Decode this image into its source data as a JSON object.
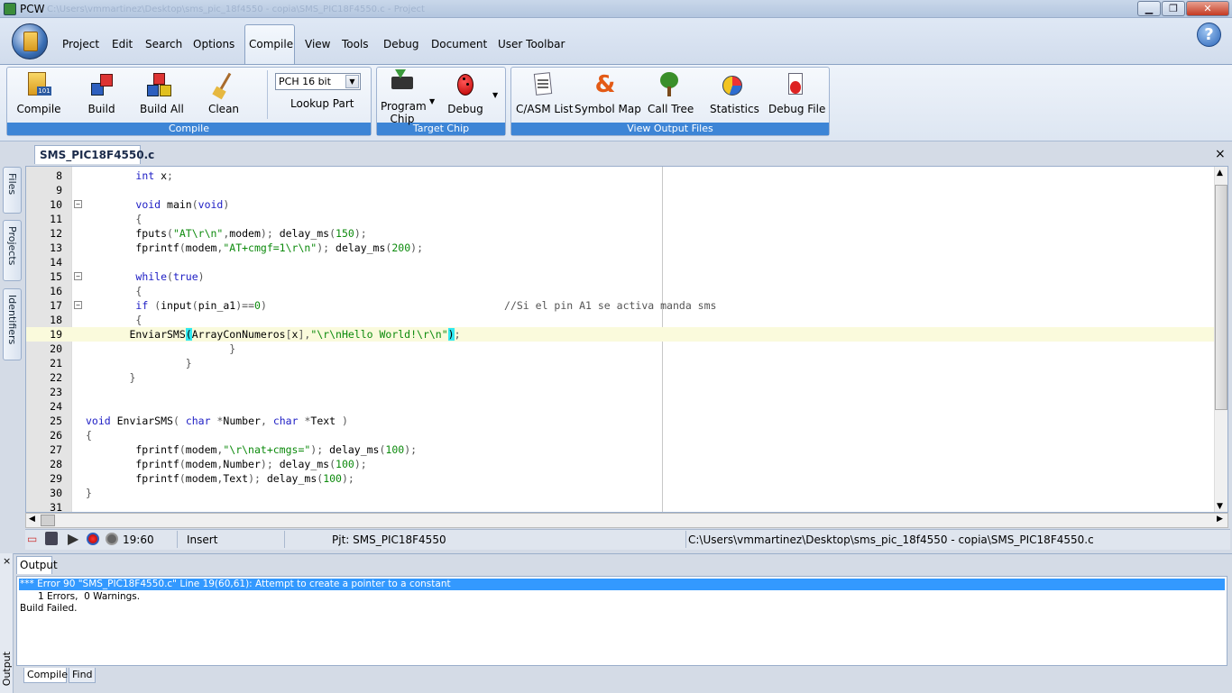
{
  "window": {
    "title": "PCW",
    "title_path": "C:\\Users\\vmmartinez\\Desktop\\sms_pic_18f4550 - copia\\SMS_PIC18F4550.c - Project",
    "controls": {
      "min": "▁",
      "max": "❐",
      "close": "✕"
    }
  },
  "menu": {
    "items": [
      "Project",
      "Edit",
      "Search",
      "Options",
      "Compile",
      "View",
      "Tools",
      "Debug",
      "Document",
      "User Toolbar"
    ],
    "active": "Compile",
    "help_icon": "?"
  },
  "ribbon": {
    "compile_group": {
      "label": "Compile",
      "buttons": [
        {
          "label": "Compile",
          "icon": "compile-icon"
        },
        {
          "label": "Build",
          "icon": "build-icon"
        },
        {
          "label": "Build All",
          "icon": "build-all-icon"
        },
        {
          "label": "Clean",
          "icon": "broom-icon"
        }
      ],
      "compiler_select": "PCH 16 bit",
      "lookup_part": "Lookup Part"
    },
    "target_group": {
      "label": "Target Chip",
      "buttons": [
        {
          "label": "Program Chip",
          "line1": "Program",
          "line2": "Chip",
          "icon": "chip-icon"
        },
        {
          "label": "Debug",
          "icon": "bug-icon"
        }
      ]
    },
    "output_group": {
      "label": "View Output Files",
      "buttons": [
        {
          "label": "C/ASM List",
          "icon": "list-icon"
        },
        {
          "label": "Symbol Map",
          "icon": "ampersand-icon"
        },
        {
          "label": "Call Tree",
          "icon": "tree-icon"
        },
        {
          "label": "Statistics",
          "icon": "pie-icon"
        },
        {
          "label": "Debug File",
          "icon": "debug-file-icon"
        }
      ]
    }
  },
  "editor": {
    "tab_name": "SMS_PIC18F4550.c",
    "close_label": "×",
    "side_tabs": [
      "Files",
      "Projects",
      "Identifiers"
    ]
  },
  "code_lines": [
    {
      "num": "8",
      "text": "        int x;"
    },
    {
      "num": "9",
      "text": ""
    },
    {
      "num": "10",
      "text": "        void main(void)"
    },
    {
      "num": "11",
      "text": "        {"
    },
    {
      "num": "12",
      "text": "        fputs(\"AT\\r\\n\",modem); delay_ms(150);"
    },
    {
      "num": "13",
      "text": "        fprintf(modem,\"AT+cmgf=1\\r\\n\"); delay_ms(200);"
    },
    {
      "num": "14",
      "text": ""
    },
    {
      "num": "15",
      "text": "        while(true)"
    },
    {
      "num": "16",
      "text": "        {"
    },
    {
      "num": "17",
      "text": "        if (input(pin_a1)==0)                                      //Si el pin A1 se activa manda sms"
    },
    {
      "num": "18",
      "text": "        {"
    },
    {
      "num": "19",
      "text": "       EnviarSMS(ArrayConNumeros[x],\"\\r\\nHello World!\\r\\n\");"
    },
    {
      "num": "20",
      "text": "                       }"
    },
    {
      "num": "21",
      "text": "                }"
    },
    {
      "num": "22",
      "text": "       }"
    },
    {
      "num": "23",
      "text": ""
    },
    {
      "num": "24",
      "text": ""
    },
    {
      "num": "25",
      "text": "void EnviarSMS( char *Number, char *Text )"
    },
    {
      "num": "26",
      "text": "{"
    },
    {
      "num": "27",
      "text": "        fprintf(modem,\"\\r\\nat+cmgs=\"); delay_ms(100);"
    },
    {
      "num": "28",
      "text": "        fprintf(modem,Number); delay_ms(100);"
    },
    {
      "num": "29",
      "text": "        fprintf(modem,Text); delay_ms(100);"
    },
    {
      "num": "30",
      "text": "}"
    },
    {
      "num": "31",
      "text": ""
    }
  ],
  "status": {
    "position": "19:60",
    "mode": "Insert",
    "project": "Pjt: SMS_PIC18F4550",
    "path": "C:\\Users\\vmmartinez\\Desktop\\sms_pic_18f4550 - copia\\SMS_PIC18F4550.c"
  },
  "output": {
    "tab": "Output",
    "side_label": "Output",
    "lines": [
      "*** Error 90 \"SMS_PIC18F4550.c\" Line 19(60,61): Attempt to create a pointer to a constant",
      "      1 Errors,  0 Warnings.",
      "Build Failed."
    ],
    "bottom_tabs": [
      "Compiler",
      "Find"
    ],
    "close_label": "×"
  },
  "colors": {
    "accent": "#3d85d6",
    "keyword": "#1c1cc4",
    "string": "#0c8a0c",
    "selection": "#3399ff"
  }
}
